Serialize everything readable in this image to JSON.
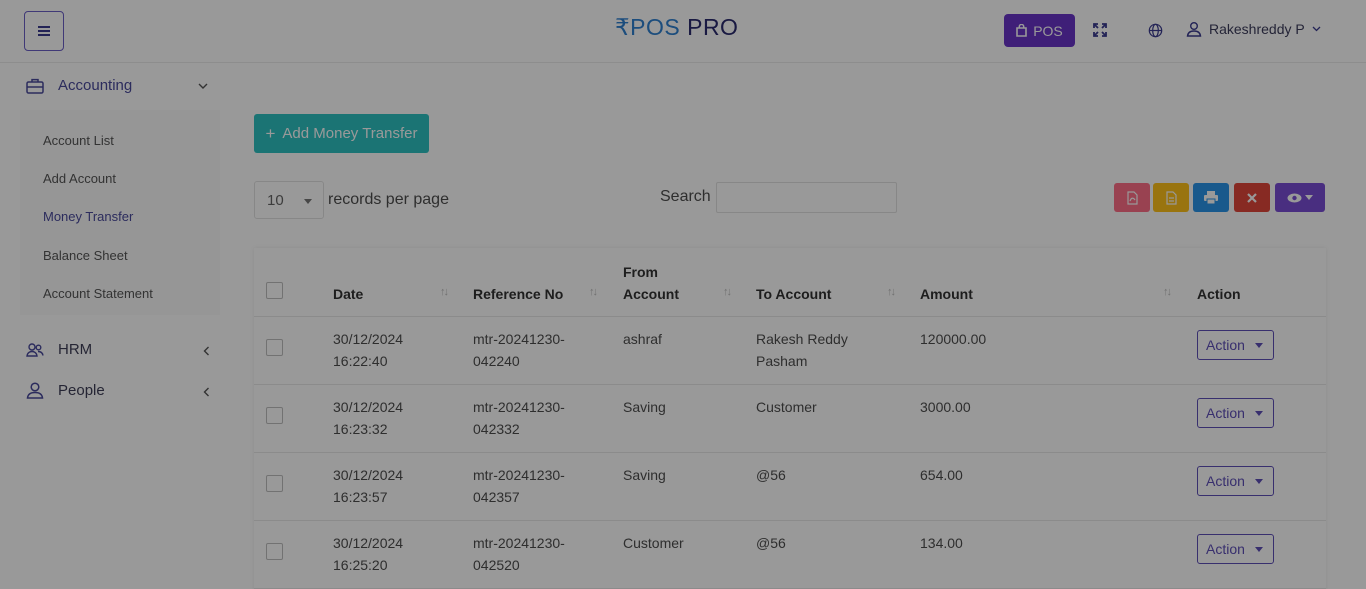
{
  "header": {
    "logo_part1": "₹POS",
    "logo_part2": "PRO",
    "pos_label": "POS",
    "user_name": "Rakeshreddy P"
  },
  "sidebar": {
    "accounting": {
      "label": "Accounting"
    },
    "submenu": [
      "Account List",
      "Add Account",
      "Money Transfer",
      "Balance Sheet",
      "Account Statement"
    ],
    "active_submenu": "Money Transfer",
    "hrm": {
      "label": "HRM"
    },
    "people": {
      "label": "People"
    }
  },
  "main": {
    "add_button_label": "Add Money Transfer",
    "per_page_value": "10",
    "per_page_label": "records per page",
    "search_label": "Search",
    "search_value": ""
  },
  "table": {
    "headers": {
      "date": "Date",
      "reference": "Reference No",
      "from_line1": "From",
      "from_line2": "Account",
      "to_account": "To Account",
      "amount": "Amount",
      "action": "Action"
    },
    "rows": [
      {
        "date1": "30/12/2024",
        "date2": "16:22:40",
        "ref1": "mtr-20241230-",
        "ref2": "042240",
        "from": "ashraf",
        "to1": "Rakesh Reddy",
        "to2": "Pasham",
        "amount": "120000.00",
        "action": "Action"
      },
      {
        "date1": "30/12/2024",
        "date2": "16:23:32",
        "ref1": "mtr-20241230-",
        "ref2": "042332",
        "from": "Saving",
        "to1": "Customer",
        "to2": "",
        "amount": "3000.00",
        "action": "Action"
      },
      {
        "date1": "30/12/2024",
        "date2": "16:23:57",
        "ref1": "mtr-20241230-",
        "ref2": "042357",
        "from": "Saving",
        "to1": "@56",
        "to2": "",
        "amount": "654.00",
        "action": "Action"
      },
      {
        "date1": "30/12/2024",
        "date2": "16:25:20",
        "ref1": "mtr-20241230-",
        "ref2": "042520",
        "from": "Customer",
        "to1": "@56",
        "to2": "",
        "amount": "134.00",
        "action": "Action"
      }
    ]
  },
  "colors": {
    "primary": "#6a35c9",
    "teal": "#2ec2c2",
    "pdf": "#ff6e87",
    "csv": "#ffc21a",
    "print": "#2a94ea",
    "delete": "#e2473b",
    "visibility": "#7b4ed6"
  }
}
